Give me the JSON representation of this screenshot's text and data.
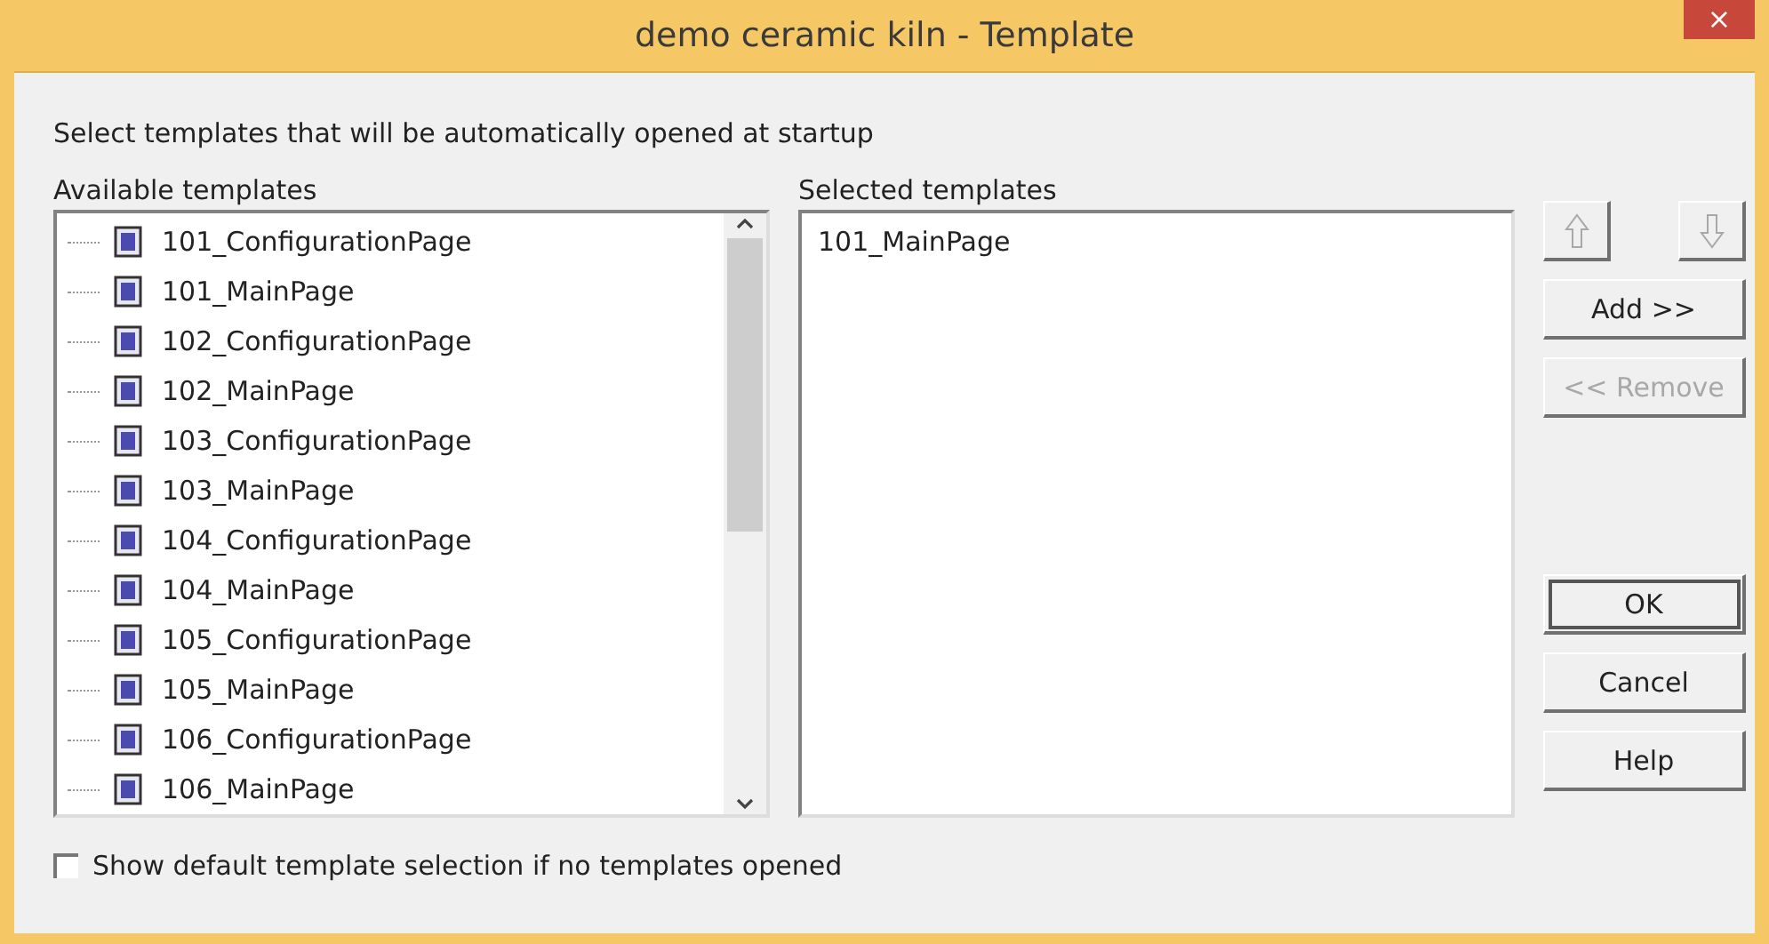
{
  "window": {
    "title": "demo ceramic kiln - Template",
    "close": "×"
  },
  "instruction": "Select templates that will be automatically opened at startup",
  "available": {
    "label": "Available templates",
    "items": [
      {
        "name": "101_ConfigurationPage",
        "selected": false
      },
      {
        "name": "101_MainPage",
        "selected": false
      },
      {
        "name": "102_ConfigurationPage",
        "selected": false
      },
      {
        "name": "102_MainPage",
        "selected": false
      },
      {
        "name": "103_ConfigurationPage",
        "selected": false
      },
      {
        "name": "103_MainPage",
        "selected": false
      },
      {
        "name": "104_ConfigurationPage",
        "selected": false
      },
      {
        "name": "104_MainPage",
        "selected": false
      },
      {
        "name": "105_ConfigurationPage",
        "selected": false
      },
      {
        "name": "105_MainPage",
        "selected": false
      },
      {
        "name": "106_ConfigurationPage",
        "selected": false
      },
      {
        "name": "106_MainPage",
        "selected": false
      }
    ]
  },
  "selected_list": {
    "label": "Selected templates",
    "items": [
      {
        "name": "101_MainPage",
        "selected": false
      }
    ]
  },
  "move_buttons": [
    {
      "kind": "up",
      "disabled": true
    },
    {
      "kind": "down",
      "disabled": true
    }
  ],
  "side_buttons": [
    {
      "label": "Add >>",
      "disabled": false,
      "default": false
    },
    {
      "label": "<< Remove",
      "disabled": true,
      "default": false
    }
  ],
  "dialog_buttons": [
    {
      "label": "OK",
      "default": true
    },
    {
      "label": "Cancel",
      "default": false
    },
    {
      "label": "Help",
      "default": false
    }
  ],
  "checkbox": {
    "label": "Show default template selection if no templates opened",
    "checked": false
  }
}
